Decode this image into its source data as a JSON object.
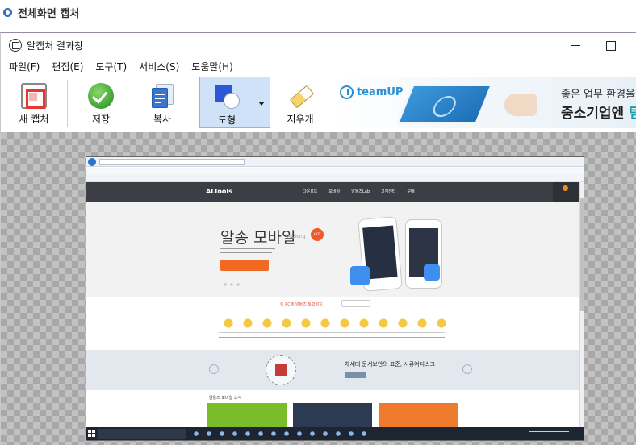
{
  "page": {
    "heading": "전체화면 캡처"
  },
  "window": {
    "title": "알캡처 결과창",
    "menu": [
      "파일(F)",
      "편집(E)",
      "도구(T)",
      "서비스(S)",
      "도움말(H)"
    ],
    "toolbar": {
      "new_capture": "새 캡처",
      "save": "저장",
      "copy": "복사",
      "shape": "도형",
      "eraser": "지우개"
    },
    "ad": {
      "brand": "teamUP",
      "line1": "좋은 업무 환경을 만",
      "line2_prefix": "중소기업엔 ",
      "line2_highlight": "팀"
    }
  },
  "capture": {
    "site_logo": "ALTools",
    "nav": [
      "다운로드",
      "모바일",
      "알툴즈Lab",
      "고객센터",
      "구매"
    ],
    "hero_title": "알송 모바일",
    "hero_sub": "ALSong",
    "hero_hot": "HOT",
    "install_title": "이 PC에 알툴즈 통합설치",
    "security_title": "차세대 문서보안의 표준, 시큐어디스크",
    "news_title": "알툴즈 모바일 소식"
  }
}
